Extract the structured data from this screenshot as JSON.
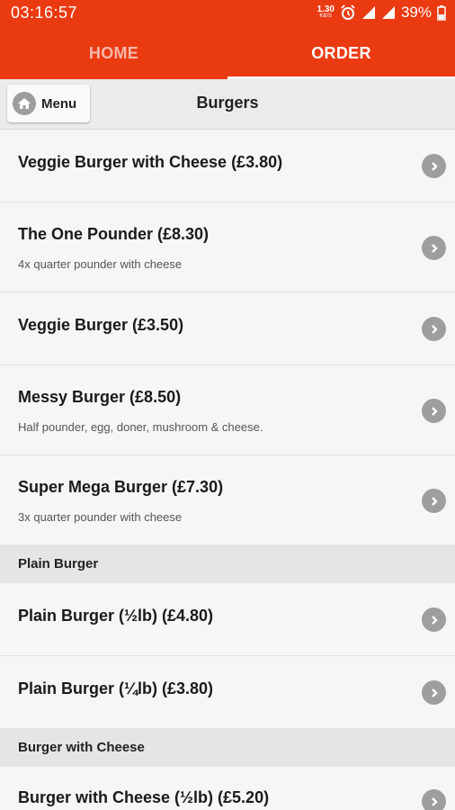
{
  "status": {
    "time": "03:16:57",
    "speed": "1.30",
    "speed_unit": "KB/S",
    "battery": "39%"
  },
  "tabs": [
    {
      "label": "HOME",
      "active": false
    },
    {
      "label": "ORDER",
      "active": true
    }
  ],
  "toolbar": {
    "menu_label": "Menu",
    "title": "Burgers"
  },
  "items": [
    {
      "name": "Veggie Burger with Cheese (£3.80)",
      "desc": ""
    },
    {
      "name": "The One Pounder (£8.30)",
      "desc": "4x quarter pounder with cheese"
    },
    {
      "name": "Veggie Burger (£3.50)",
      "desc": ""
    },
    {
      "name": "Messy Burger (£8.50)",
      "desc": "Half pounder, egg, doner, mushroom & cheese."
    },
    {
      "name": "Super Mega Burger (£7.30)",
      "desc": "3x quarter pounder with cheese"
    }
  ],
  "sections": [
    {
      "label": "Plain Burger",
      "items": [
        {
          "name": "Plain Burger (½lb) (£4.80)"
        },
        {
          "name": "Plain Burger (¼lb) (£3.80)"
        }
      ]
    },
    {
      "label": "Burger with Cheese",
      "items": [
        {
          "name": "Burger with Cheese (½lb) (£5.20)"
        }
      ]
    }
  ],
  "colors": {
    "brand": "#ea3a12",
    "chevron": "#9e9e9e"
  }
}
